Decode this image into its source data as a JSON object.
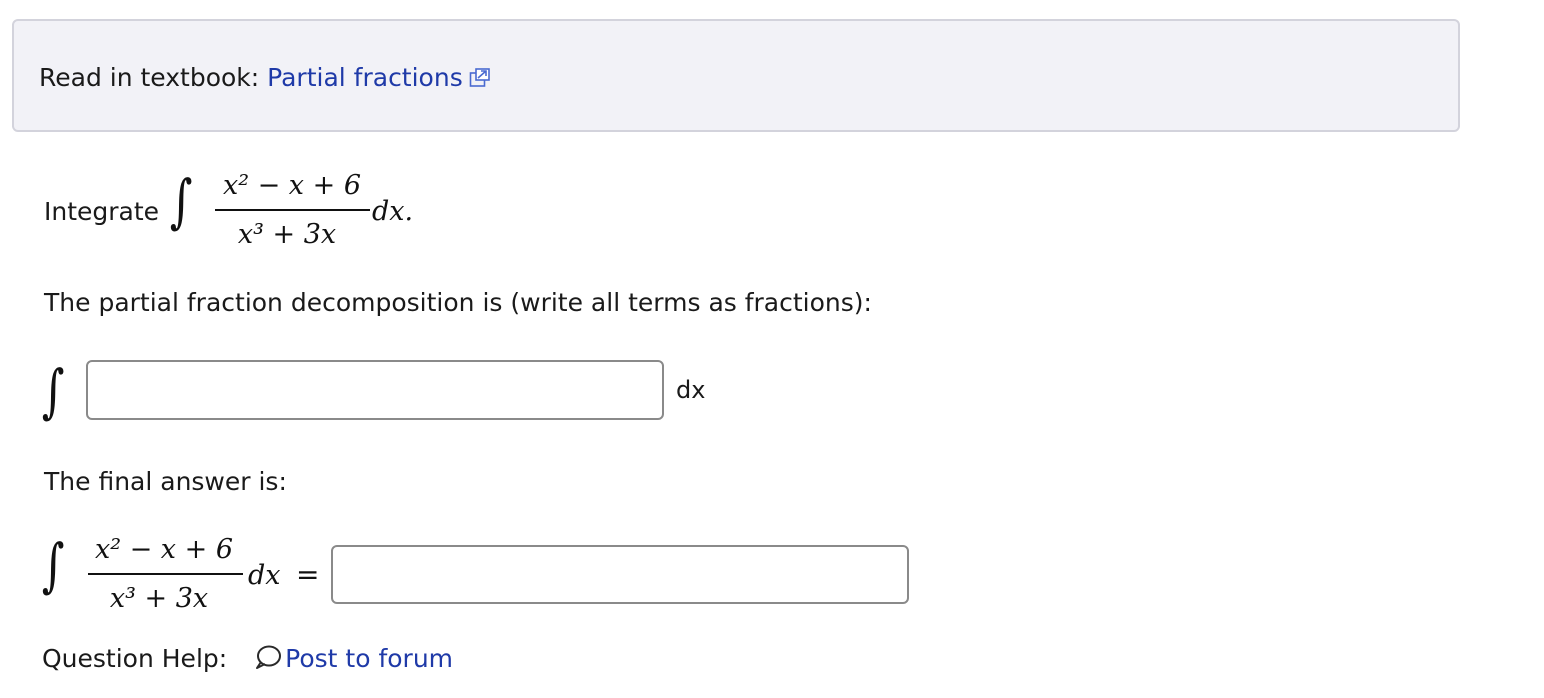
{
  "textbook": {
    "prefix": "Read in textbook: ",
    "link_label": "Partial fractions"
  },
  "problem": {
    "label": "Integrate",
    "numerator": "x² − x + 6",
    "denominator": "x³ + 3x",
    "differential": "dx."
  },
  "decomposition": {
    "instruction": "The partial fraction decomposition is (write all terms as fractions):",
    "integral_sign": "∫",
    "input_value": "",
    "suffix": "dx"
  },
  "final": {
    "label": "The final answer is:",
    "integral_sign": "∫",
    "numerator": "x² − x + 6",
    "denominator": "x³ + 3x",
    "differential": "dx",
    "equals": "=",
    "input_value": ""
  },
  "help": {
    "label": "Question Help:",
    "forum_link": "Post to forum"
  },
  "icons": {
    "external_link": "external-link-icon",
    "forum": "speech-bubble-icon"
  },
  "colors": {
    "link": "#1f3aa8",
    "panel_bg": "#f2f2f7",
    "panel_border": "#d3d3dc",
    "input_border": "#8a8a8a"
  }
}
